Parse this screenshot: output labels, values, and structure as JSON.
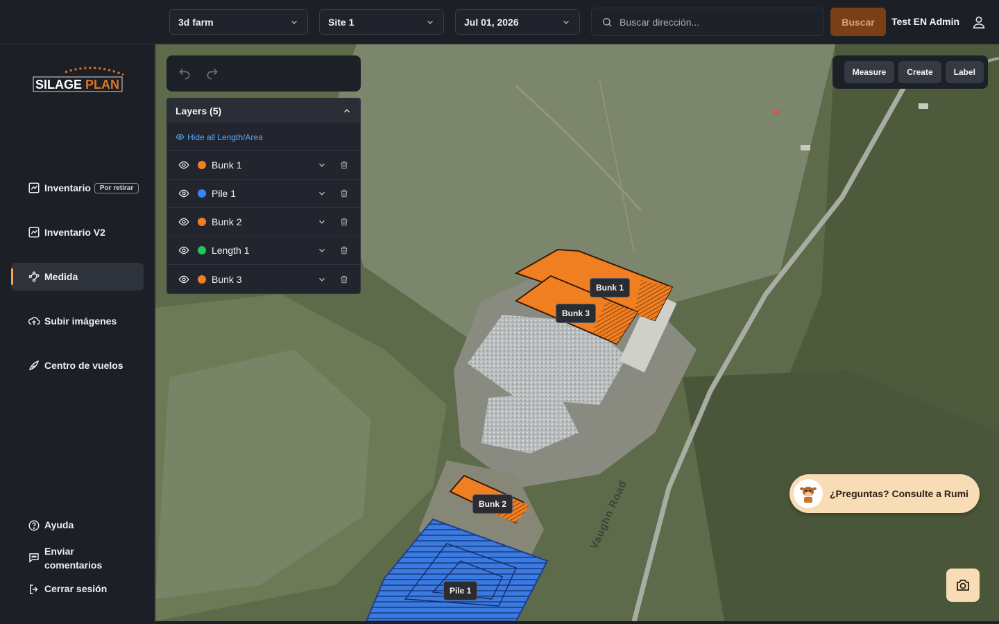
{
  "header": {
    "farm_select": "3d farm",
    "site_select": "Site 1",
    "date_select": "Jul 01, 2026",
    "search_placeholder": "Buscar dirección...",
    "search_button": "Buscar",
    "user_name": "Test EN Admin"
  },
  "sidebar": {
    "logo_text_a": "SILAGE",
    "logo_text_b": "PLAN",
    "items": [
      {
        "label": "Inventario",
        "badge": "Por retirar",
        "icon": "chart-icon"
      },
      {
        "label": "Inventario V2",
        "icon": "chart-icon"
      },
      {
        "label": "Medida",
        "icon": "measure-icon",
        "active": true
      },
      {
        "label": "Subir imágenes",
        "icon": "cloud-upload-icon"
      },
      {
        "label": "Centro de vuelos",
        "icon": "drone-icon"
      }
    ],
    "footer": {
      "help": "Ayuda",
      "feedback": "Enviar comentarios",
      "logout": "Cerrar sesión"
    }
  },
  "layers": {
    "title": "Layers (5)",
    "hide_link": "Hide all Length/Area",
    "items": [
      {
        "name": "Bunk 1",
        "color": "#f07f22"
      },
      {
        "name": "Pile 1",
        "color": "#3b82f6"
      },
      {
        "name": "Bunk 2",
        "color": "#f07f22"
      },
      {
        "name": "Length 1",
        "color": "#22c55e"
      },
      {
        "name": "Bunk 3",
        "color": "#f07f22"
      }
    ]
  },
  "tools": {
    "measure": "Measure",
    "create": "Create",
    "label": "Label"
  },
  "map": {
    "labels": {
      "bunk1": "Bunk 1",
      "bunk3": "Bunk 3",
      "bunk2": "Bunk 2",
      "pile1": "Pile 1"
    },
    "road_name": "Vaughn Road"
  },
  "rumi": {
    "text": "¿Preguntas? Consulte a Rumi"
  },
  "colors": {
    "accent": "#f2a65a",
    "bunk": "#f07f22",
    "pile": "#3b82f6",
    "search_button_bg": "#7a3f14"
  }
}
